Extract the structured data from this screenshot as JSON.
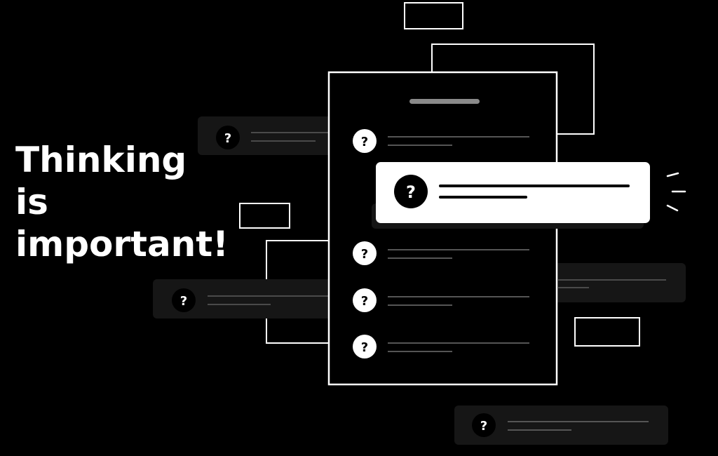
{
  "headline": {
    "lines": [
      "Thinking",
      "is",
      "important!"
    ]
  },
  "icons": {
    "question": "?"
  },
  "colors": {
    "background": "#000000",
    "foreground": "#ffffff",
    "muted_card": "#161616",
    "line_gray": "#555555"
  }
}
